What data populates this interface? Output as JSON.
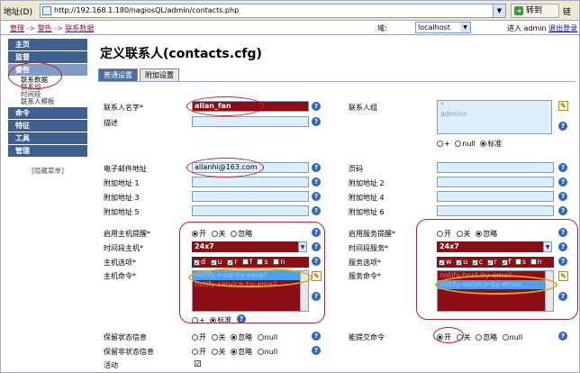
{
  "address_bar": {
    "label": "地址(D)",
    "url": "http://192.168.1.180/nagiosQL/admin/contacts.php",
    "go_label": "转到",
    "links_label": "链"
  },
  "breadcrumb": {
    "items": [
      "管理",
      "警告",
      "联系数据"
    ],
    "separator": "->"
  },
  "domain": {
    "label": "域:",
    "value": "localhost"
  },
  "login": {
    "text": "进入 admin",
    "logout": "退出登录"
  },
  "sidebar": {
    "items": [
      {
        "label": "主页",
        "active": false
      },
      {
        "label": "监督",
        "active": false
      },
      {
        "label": "警告",
        "active": true,
        "subitems": [
          "联系数据",
          "联系组",
          "时间段",
          "联系人模板"
        ]
      },
      {
        "label": "命令",
        "active": false
      },
      {
        "label": "特征",
        "active": false
      },
      {
        "label": "工具",
        "active": false
      },
      {
        "label": "管理",
        "active": false
      }
    ],
    "hide_menu": "[隐藏菜单]"
  },
  "page_title": "定义联系人(contacts.cfg)",
  "tabs": [
    "普通设置",
    "附加设置"
  ],
  "form": {
    "contact_name_label": "联系人名字*",
    "contact_name_value": "allan_fan",
    "contact_group_label": "联系人组",
    "contact_group_list": [
      "*",
      "admins"
    ],
    "alias_label": "描述",
    "group_radios": [
      "+",
      "null",
      "标准"
    ],
    "email_label": "电子邮件地址",
    "email_value": "allanhi@163.com",
    "pager_label": "页码",
    "addr1_label": "附加地址 1",
    "addr2_label": "附加地址 2",
    "addr3_label": "附加地址 3",
    "addr4_label": "附加地址 4",
    "addr5_label": "附加地址 5",
    "addr6_label": "附加地址 6",
    "host_notif_label": "启用主机提醒*",
    "service_notif_label": "启用服务提醒*",
    "radio3": [
      "开",
      "关",
      "忽略"
    ],
    "host_period_label": "时间段主机*",
    "host_period_value": "24x7",
    "service_period_label": "时间段服务*",
    "service_period_value": "24x7",
    "host_options_label": "主机选项*",
    "host_options": [
      "d",
      "u",
      "r",
      "f",
      "s",
      "n"
    ],
    "service_options_label": "服务选项*",
    "service_options": [
      "w",
      "u",
      "c",
      "r",
      "f",
      "s",
      "n"
    ],
    "host_cmd_label": "主机命令*",
    "host_cmd_list": [
      "notify-host-by-email",
      "notify-service-by-email"
    ],
    "service_cmd_label": "服务命令*",
    "service_cmd_list": [
      "notify-host-by-email",
      "notify-service-by-email"
    ],
    "cmd_radios": [
      "+",
      "标准"
    ],
    "retain_status_label": "保留状态信息",
    "retain_nonstatus_label": "保留非状态信息",
    "radio4": [
      "开",
      "关",
      "忽略",
      "null"
    ],
    "can_submit_label": "能提交命令",
    "active_label": "活动",
    "help_glyph": "?",
    "edit_glyph": "✎",
    "check_glyph": "✓",
    "dropdown_glyph": "▼"
  }
}
